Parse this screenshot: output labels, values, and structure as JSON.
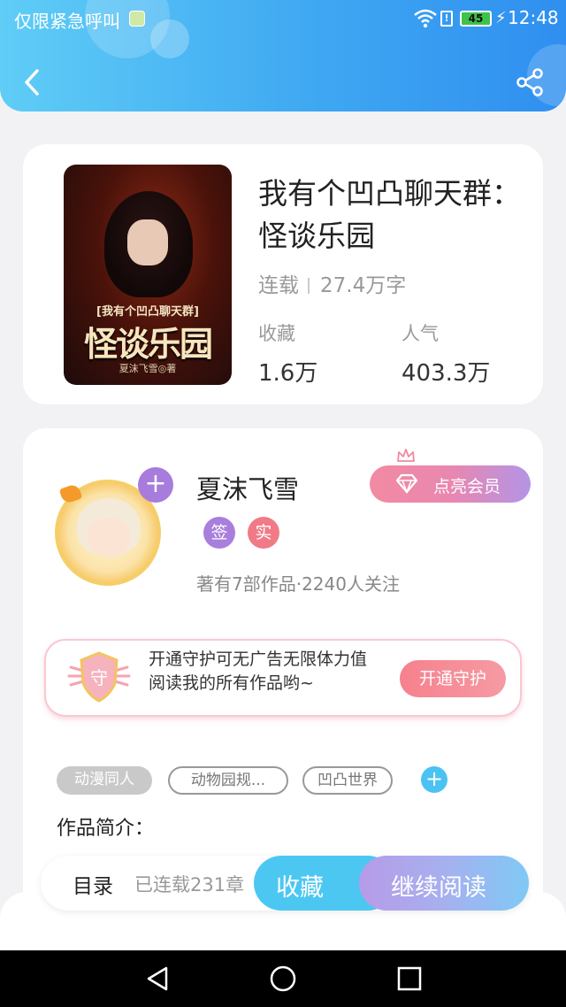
{
  "status_bar": {
    "carrier": "仅限紧急呼叫",
    "sim_label": "!",
    "battery": "45",
    "time": "12:48"
  },
  "header": {
    "back_icon": "chevron-left-icon",
    "share_icon": "share-icon",
    "gradient": [
      "#5fcdf6",
      "#2f8ff0"
    ]
  },
  "book": {
    "title": "我有个凹凸聊天群：怪谈乐园",
    "cover": {
      "subtitle": "[我有个凹凸聊天群]",
      "big_title": "怪谈乐园",
      "author": "夏沫飞雪◎著"
    },
    "status": "连载",
    "word_count": "27.4万字",
    "stats": [
      {
        "label": "收藏",
        "value": "1.6万"
      },
      {
        "label": "人气",
        "value": "403.3万"
      }
    ]
  },
  "author": {
    "name": "夏沫飞雪",
    "badges": [
      {
        "text": "签",
        "color": "#a87fdc"
      },
      {
        "text": "实",
        "color": "#f07b86"
      }
    ],
    "meta": "著有7部作品·2240人关注",
    "follow_symbol": "+",
    "vip_button": "点亮会员"
  },
  "guard": {
    "shield_text": "守",
    "text": "开通守护可无广告无限体力值阅读我的所有作品哟~",
    "button": "开通守护"
  },
  "tags": [
    {
      "label": "动漫同人",
      "style": "filled"
    },
    {
      "label": "动物园规...",
      "style": "outline"
    },
    {
      "label": "凹凸世界",
      "style": "outline"
    }
  ],
  "tag_add_symbol": "+",
  "intro_label": "作品简介：",
  "action_bar": {
    "toc_label": "目录",
    "toc_count": "已连载231章",
    "favorite": "收藏",
    "continue": "继续阅读"
  },
  "colors": {
    "accent_blue": "#4cc7f2",
    "accent_purple": "#a77cdc",
    "accent_pink": "#f28aa2"
  }
}
